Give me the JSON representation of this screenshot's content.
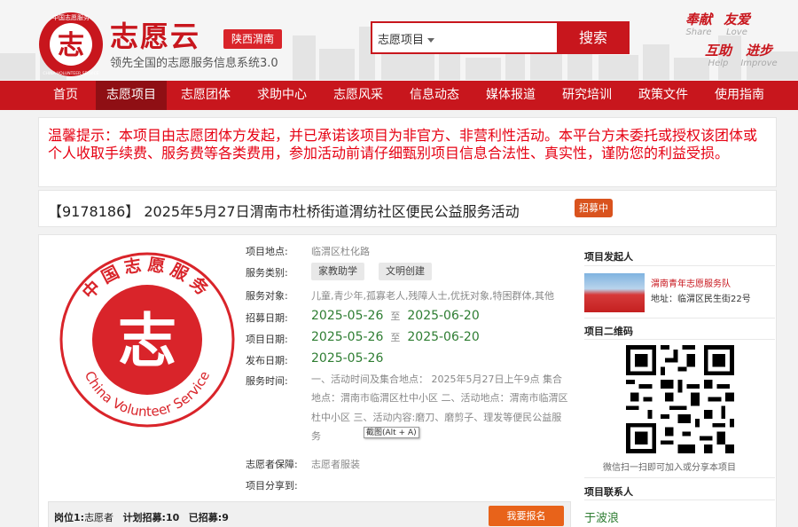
{
  "header": {
    "logo_ring_text": "中国志愿服务",
    "logo_ring_en": "CHINA VOLUNTEER SERVICE",
    "site_name": "志愿云",
    "region": "陕西渭南",
    "tagline": "领先全国的志愿服务信息系统3.0",
    "search": {
      "category": "志愿项目",
      "value": "",
      "button": "搜索"
    },
    "mottos": [
      {
        "cn": "奉献",
        "en": "Share"
      },
      {
        "cn": "友爱",
        "en": "Love"
      },
      {
        "cn": "互助",
        "en": "Help"
      },
      {
        "cn": "进步",
        "en": "Improve"
      }
    ]
  },
  "nav": {
    "items": [
      "首页",
      "志愿项目",
      "志愿团体",
      "求助中心",
      "志愿风采",
      "信息动态",
      "媒体报道",
      "研究培训",
      "政策文件",
      "使用指南"
    ],
    "active_index": 1
  },
  "notice": {
    "text": "温馨提示：本项目由志愿团体方发起，并已承诺该项目为非官方、非营利性活动。本平台方未委托或授权该团体或个人收取手续费、服务费等各类费用，参加活动前请仔细甄别项目信息合法性、真实性，谨防您的利益受损。"
  },
  "project": {
    "id_title": "【9178186】 2025年5月27日渭南市杜桥街道渭纺社区便民公益服务活动",
    "status": "招募中",
    "emblem_cn": "中国志愿服务",
    "emblem_en": "China Volunteer Service",
    "emblem_char": "志",
    "location_label": "项目地点:",
    "location": "临渭区杜化路",
    "category_label": "服务类别:",
    "categories": [
      "家教助学",
      "文明创建"
    ],
    "target_label": "服务对象:",
    "targets": "儿童,青少年,孤寡老人,残障人士,优抚对象,特困群体,其他",
    "recruit_label": "招募日期:",
    "recruit_start": "2025-05-26",
    "recruit_end": "2025-06-20",
    "period_label": "项目日期:",
    "period_start": "2025-05-26",
    "period_end": "2025-06-20",
    "to": "至",
    "publish_label": "发布日期:",
    "publish_date": "2025-05-26",
    "time_label": "服务时间:",
    "time_desc": "一、活动时间及集合地点： 2025年5月27日上午9点 集合地点：渭南市临渭区杜中小区 二、活动地点：渭南市临渭区杜中小区 三、活动内容:磨刀、磨剪子、理发等便民公益服务",
    "tooltip": "截图(Alt + A)",
    "guarantee_label": "志愿者保障:",
    "guarantee": "志愿者服装",
    "share_label": "项目分享到:",
    "job": {
      "post_label": "岗位1:",
      "post": "志愿者",
      "plan_label": "计划招募:",
      "plan": "10",
      "done_label": "已招募:",
      "done": "9",
      "apply": "我要报名"
    }
  },
  "sidebar": {
    "initiator_title": "项目发起人",
    "org_name": "渭南青年志愿服务队",
    "org_addr": "地址：临渭区民生街22号",
    "qr_title": "项目二维码",
    "qr_caption": "微信扫一扫即可加入或分享本项目",
    "contact_title": "项目联系人",
    "contact_name": "于波浪"
  }
}
